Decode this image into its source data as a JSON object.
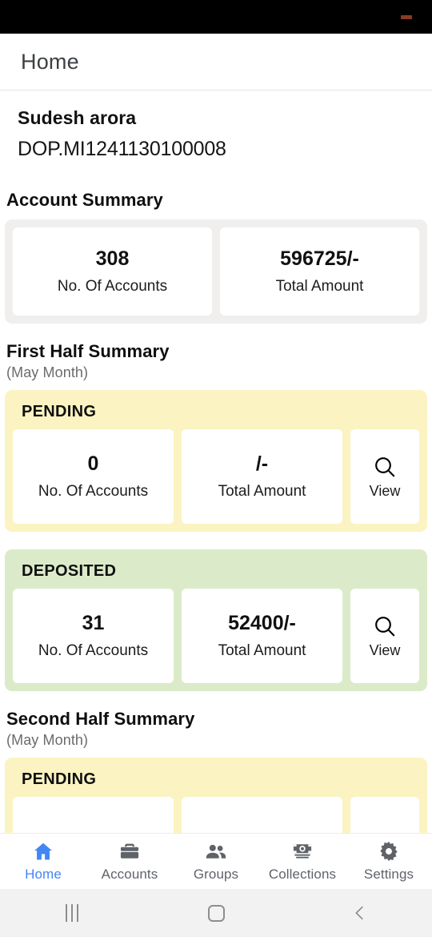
{
  "status_bar": {
    "indicator": "notification-dash",
    "color": "#8c3a23"
  },
  "header": {
    "title": "Home"
  },
  "user": {
    "name": "Sudesh arora",
    "id": "DOP.MI1241130100008"
  },
  "account_summary": {
    "title": "Account Summary",
    "cards": [
      {
        "value": "308",
        "label": "No. Of Accounts"
      },
      {
        "value": "596725/-",
        "label": "Total Amount"
      }
    ]
  },
  "first_half": {
    "title": "First Half Summary",
    "subtitle": "(May Month)",
    "pending": {
      "label": "PENDING",
      "accounts_value": "0",
      "accounts_label": "No. Of Accounts",
      "amount_value": "/-",
      "amount_label": "Total Amount",
      "view_label": "View",
      "color": "#fbf4c2"
    },
    "deposited": {
      "label": "DEPOSITED",
      "accounts_value": "31",
      "accounts_label": "No. Of Accounts",
      "amount_value": "52400/-",
      "amount_label": "Total Amount",
      "view_label": "View",
      "color": "#dbebc9"
    }
  },
  "second_half": {
    "title": "Second Half Summary",
    "subtitle": "(May Month)",
    "pending": {
      "label": "PENDING",
      "color": "#fbf4c2"
    }
  },
  "tabbar": {
    "active": "Home",
    "active_color": "#4285f4",
    "inactive_color": "#5f6368",
    "items": [
      {
        "label": "Home",
        "icon": "home-icon"
      },
      {
        "label": "Accounts",
        "icon": "briefcase-icon"
      },
      {
        "label": "Groups",
        "icon": "people-icon"
      },
      {
        "label": "Collections",
        "icon": "money-icon"
      },
      {
        "label": "Settings",
        "icon": "gear-icon"
      }
    ]
  },
  "system_nav": {
    "recents": "recents-icon",
    "home": "home-square-icon",
    "back": "back-chevron-icon"
  }
}
